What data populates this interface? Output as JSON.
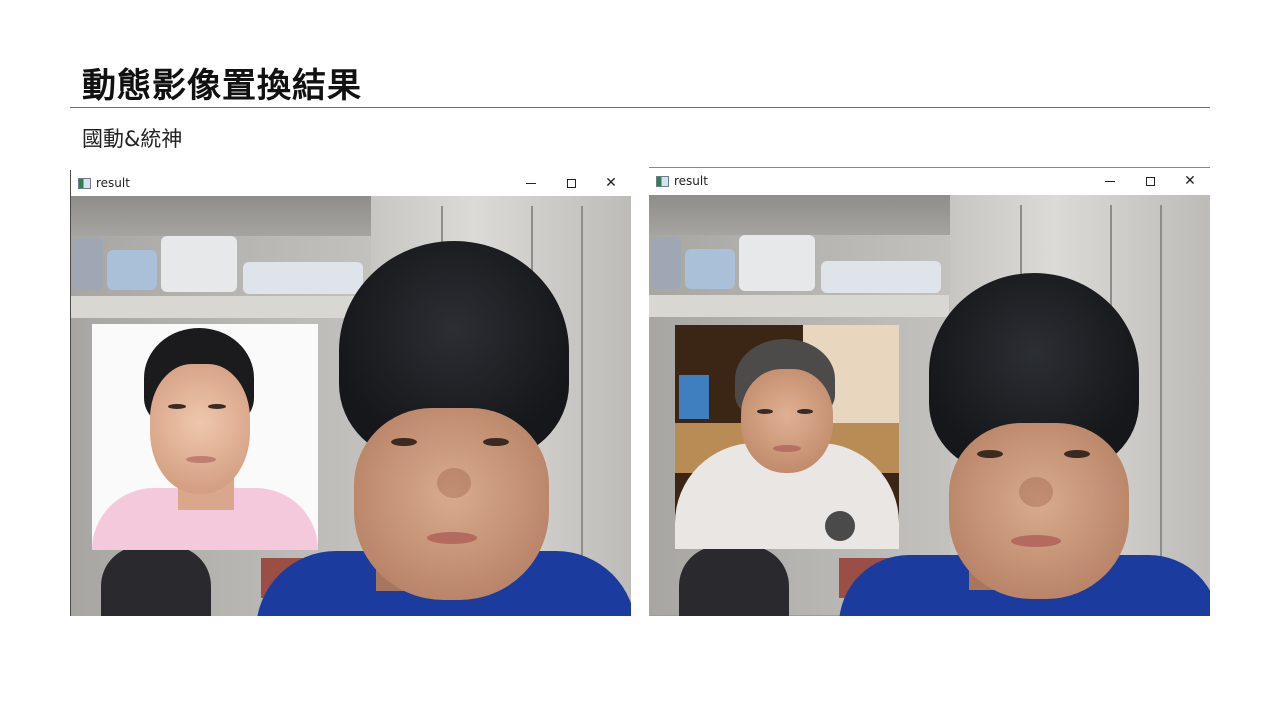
{
  "slide": {
    "title": "動態影像置換結果",
    "subtitle": "國動&統神"
  },
  "windows": [
    {
      "title": "result",
      "controls": {
        "minimize": "—",
        "maximize": "☐",
        "close": "✕"
      }
    },
    {
      "title": "result",
      "controls": {
        "minimize": "—",
        "maximize": "☐",
        "close": "✕"
      }
    }
  ],
  "colors": {
    "shirt": "#1b3c9e",
    "inset_left_shirt": "#f4c9dc",
    "inset_right_shirt": "#e9e6e3"
  }
}
